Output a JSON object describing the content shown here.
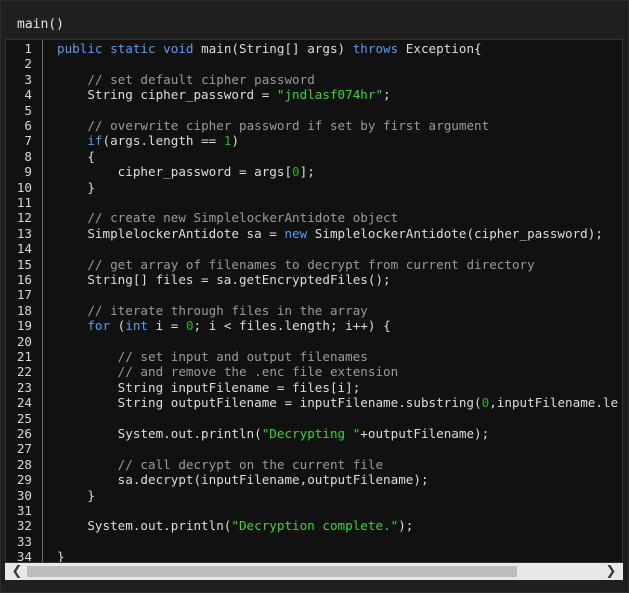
{
  "title": "main()",
  "lines": [
    [
      [
        "kw",
        "public static void"
      ],
      [
        "t",
        " main(String[] args) "
      ],
      [
        "kw",
        "throws"
      ],
      [
        "t",
        " Exception{"
      ]
    ],
    [],
    [
      [
        "t",
        "    "
      ],
      [
        "cm",
        "// set default cipher password"
      ]
    ],
    [
      [
        "t",
        "    String cipher_password = "
      ],
      [
        "st",
        "\"jndlasf074hr\""
      ],
      [
        "t",
        ";"
      ]
    ],
    [],
    [
      [
        "t",
        "    "
      ],
      [
        "cm",
        "// overwrite cipher password if set by first argument"
      ]
    ],
    [
      [
        "t",
        "    "
      ],
      [
        "kw",
        "if"
      ],
      [
        "t",
        "(args.length == "
      ],
      [
        "nm",
        "1"
      ],
      [
        "t",
        ")"
      ]
    ],
    [
      [
        "t",
        "    {"
      ]
    ],
    [
      [
        "t",
        "        cipher_password = args["
      ],
      [
        "nm",
        "0"
      ],
      [
        "t",
        "];"
      ]
    ],
    [
      [
        "t",
        "    }"
      ]
    ],
    [],
    [
      [
        "t",
        "    "
      ],
      [
        "cm",
        "// create new SimplelockerAntidote object"
      ]
    ],
    [
      [
        "t",
        "    SimplelockerAntidote sa = "
      ],
      [
        "kw",
        "new"
      ],
      [
        "t",
        " SimplelockerAntidote(cipher_password);"
      ]
    ],
    [],
    [
      [
        "t",
        "    "
      ],
      [
        "cm",
        "// get array of filenames to decrypt from current directory"
      ]
    ],
    [
      [
        "t",
        "    String[] files = sa.getEncryptedFiles();"
      ]
    ],
    [],
    [
      [
        "t",
        "    "
      ],
      [
        "cm",
        "// iterate through files in the array"
      ]
    ],
    [
      [
        "t",
        "    "
      ],
      [
        "kw",
        "for"
      ],
      [
        "t",
        " ("
      ],
      [
        "kw",
        "int"
      ],
      [
        "t",
        " i = "
      ],
      [
        "nm",
        "0"
      ],
      [
        "t",
        "; i < files.length; i++) {"
      ]
    ],
    [],
    [
      [
        "t",
        "        "
      ],
      [
        "cm",
        "// set input and output filenames"
      ]
    ],
    [
      [
        "t",
        "        "
      ],
      [
        "cm",
        "// and remove the .enc file extension"
      ]
    ],
    [
      [
        "t",
        "        String inputFilename = files[i];"
      ]
    ],
    [
      [
        "t",
        "        String outputFilename = inputFilename.substring("
      ],
      [
        "nm",
        "0"
      ],
      [
        "t",
        ",inputFilename.le"
      ]
    ],
    [],
    [
      [
        "t",
        "        System.out.println("
      ],
      [
        "st",
        "\"Decrypting \""
      ],
      [
        "t",
        "+outputFilename);"
      ]
    ],
    [],
    [
      [
        "t",
        "        "
      ],
      [
        "cm",
        "// call decrypt on the current file"
      ]
    ],
    [
      [
        "t",
        "        sa.decrypt(inputFilename,outputFilename);"
      ]
    ],
    [
      [
        "t",
        "    }"
      ]
    ],
    [],
    [
      [
        "t",
        "    System.out.println("
      ],
      [
        "st",
        "\"Decryption complete.\""
      ],
      [
        "t",
        ");"
      ]
    ],
    [],
    [
      [
        "t",
        "}"
      ]
    ]
  ],
  "scroll_left": "❮",
  "scroll_right": "❯",
  "colors": {
    "keyword": "#5b9bf0",
    "comment": "#9a9a9a",
    "string": "#38d638",
    "number": "#2fae2f"
  }
}
